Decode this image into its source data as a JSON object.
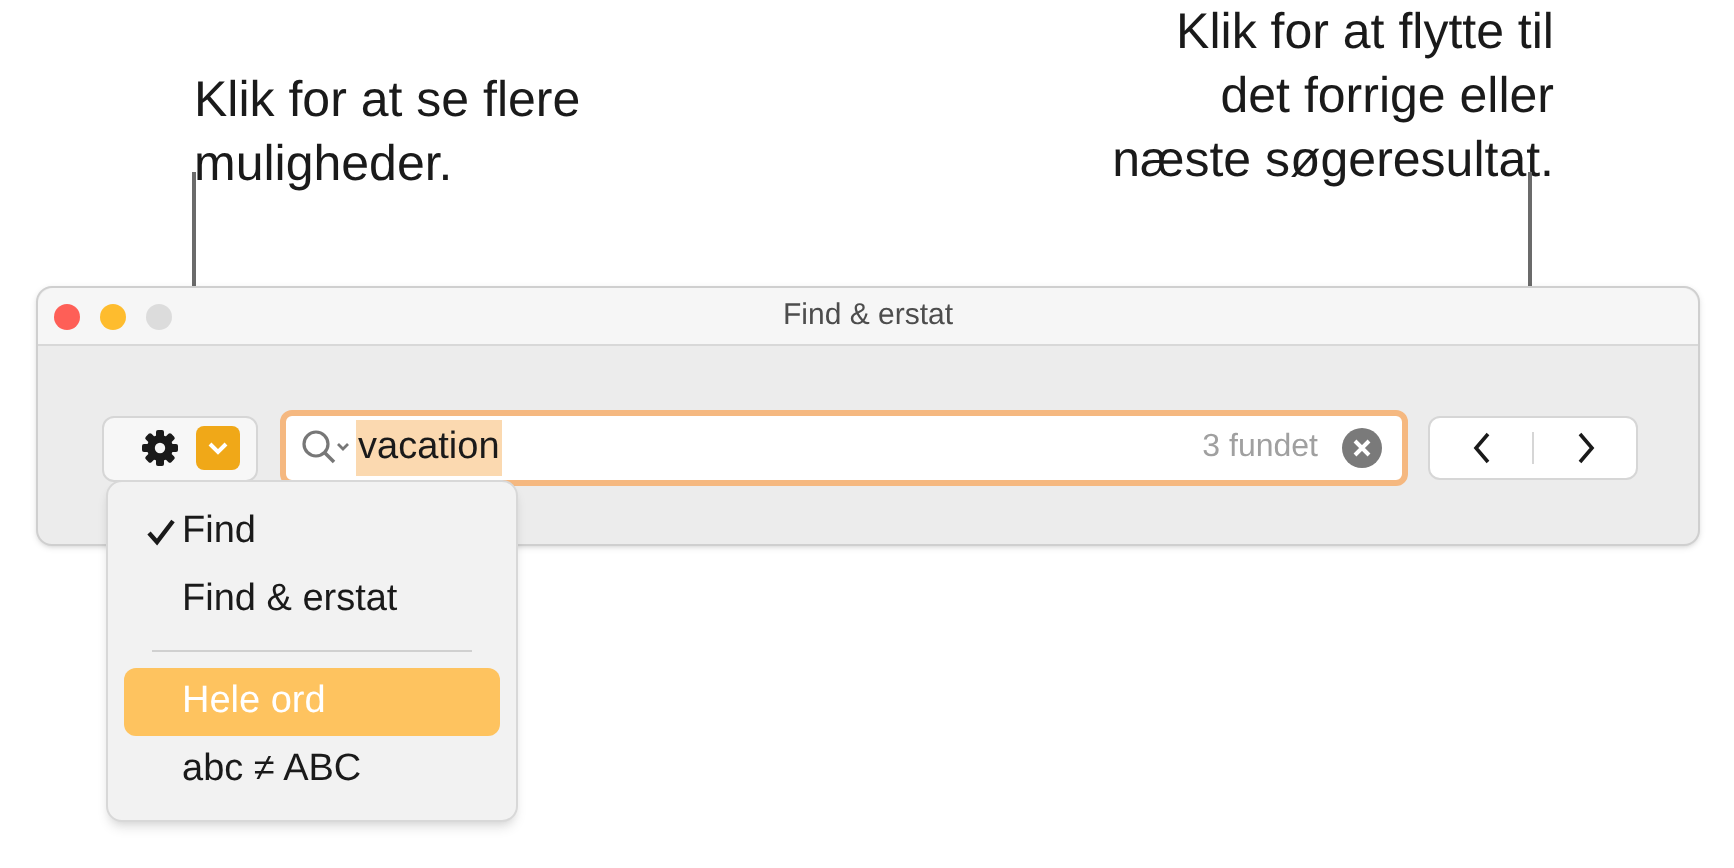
{
  "callouts": [
    {
      "lines": [
        "Klik for at se flere",
        "muligheder."
      ]
    },
    {
      "lines": [
        "Klik for at flytte til",
        "det forrige eller",
        "næste søgeresultat."
      ]
    }
  ],
  "window": {
    "title": "Find & erstat"
  },
  "search_field": {
    "value": "vacation",
    "value_highlighted": true,
    "result_count": "3 fundet"
  },
  "menu": {
    "items": [
      {
        "kind": "option",
        "label": "Find",
        "checked": true,
        "highlighted": false
      },
      {
        "kind": "option",
        "label": "Find & erstat",
        "checked": false,
        "highlighted": false
      },
      {
        "kind": "separator"
      },
      {
        "kind": "option",
        "label": "Hele ord",
        "checked": false,
        "highlighted": true
      },
      {
        "kind": "option",
        "label": "abc ≠ ABC",
        "checked": false,
        "highlighted": false
      }
    ]
  }
}
